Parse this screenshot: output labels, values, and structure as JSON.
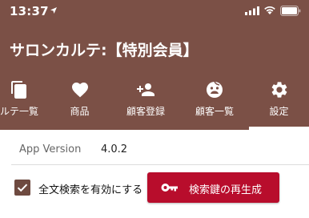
{
  "status_bar": {
    "time": "13:37"
  },
  "app": {
    "title": "サロンカルテ:【特別会員】"
  },
  "tabs": [
    {
      "label": "ルテ一覧",
      "icon": "copy-icon"
    },
    {
      "label": "商品",
      "icon": "heart-icon"
    },
    {
      "label": "顧客登録",
      "icon": "add-user-icon"
    },
    {
      "label": "顧客一覧",
      "icon": "face-icon"
    },
    {
      "label": "設定",
      "icon": "gear-icon"
    }
  ],
  "active_tab": "設定",
  "settings": {
    "version_label": "App Version",
    "version_value": "4.0.2",
    "fulltext_search_label": "全文検索を有効にする",
    "fulltext_search_checked": true,
    "regenerate_button_label": "検索鍵の再生成"
  },
  "colors": {
    "header_bg": "#7b5046",
    "button_bg": "#b80d2c",
    "checkbox_bg": "#6e4a40"
  }
}
